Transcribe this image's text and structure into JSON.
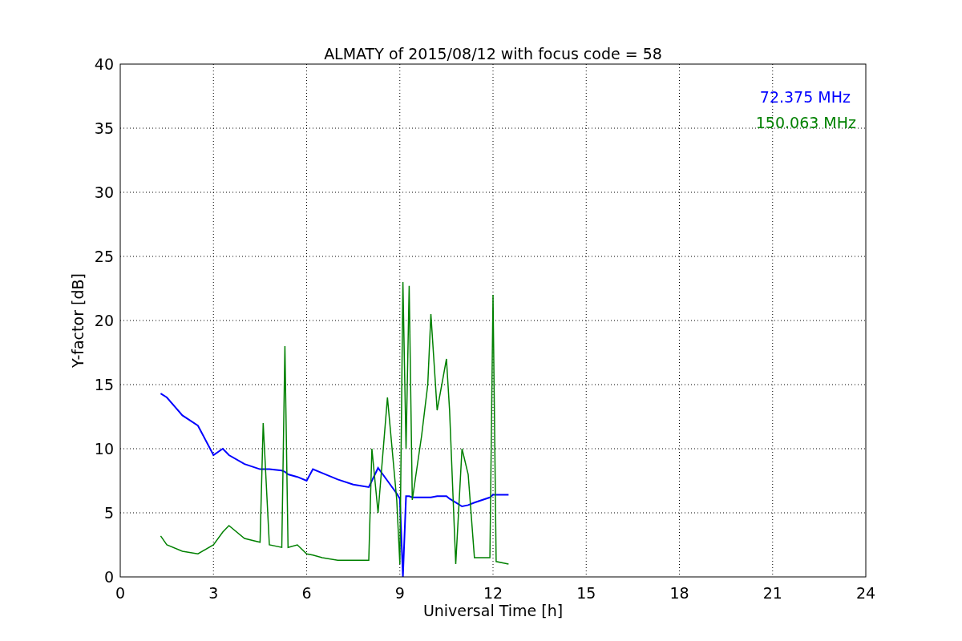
{
  "chart_data": {
    "type": "line",
    "title": "ALMATY of 2015/08/12 with focus code = 58",
    "xlabel": "Universal Time [h]",
    "ylabel": "Y-factor [dB]",
    "xlim": [
      0,
      24
    ],
    "ylim": [
      0,
      40
    ],
    "grid": true,
    "xticks": [
      0,
      3,
      6,
      9,
      12,
      15,
      18,
      21,
      24
    ],
    "yticks": [
      0,
      5,
      10,
      15,
      20,
      25,
      30,
      35,
      40
    ],
    "x": [
      1.3,
      1.5,
      2,
      2.5,
      3,
      3.3,
      3.5,
      4,
      4.5,
      4.6,
      4.8,
      5.2,
      5.3,
      5.4,
      5.7,
      6,
      6.2,
      6.5,
      7,
      7.5,
      8,
      8.1,
      8.3,
      8.6,
      8.9,
      9,
      9.1,
      9.2,
      9.3,
      9.4,
      9.7,
      9.9,
      10,
      10.2,
      10.5,
      10.6,
      10.8,
      11,
      11.2,
      11.4,
      11.9,
      12,
      12.1,
      12.5
    ],
    "series": [
      {
        "name": "72.375 MHz",
        "color": "#0000ff",
        "values": [
          14.3,
          14,
          12.6,
          11.8,
          9.5,
          10,
          9.5,
          8.8,
          8.4,
          8.4,
          8.4,
          8.3,
          8.2,
          8,
          7.8,
          7.5,
          8.4,
          8.1,
          7.6,
          7.2,
          7,
          7.5,
          8.5,
          7.5,
          6.5,
          6.1,
          0,
          6.3,
          6.3,
          6.2,
          6.2,
          6.2,
          6.2,
          6.3,
          6.3,
          6.1,
          5.8,
          5.5,
          5.6,
          5.8,
          6.2,
          6.4,
          6.4,
          6.4
        ]
      },
      {
        "name": "150.063 MHz",
        "color": "#008000",
        "values": [
          3.2,
          2.5,
          2,
          1.8,
          2.5,
          3.5,
          4,
          3,
          2.7,
          12,
          2.5,
          2.3,
          18,
          2.3,
          2.5,
          1.8,
          1.7,
          1.5,
          1.3,
          1.3,
          1.3,
          10,
          5,
          14,
          6,
          1,
          23,
          10,
          22.7,
          6,
          11,
          15,
          20.5,
          13,
          17,
          13,
          1,
          10,
          8,
          1.5,
          1.5,
          22,
          1.2,
          1
        ]
      }
    ]
  }
}
